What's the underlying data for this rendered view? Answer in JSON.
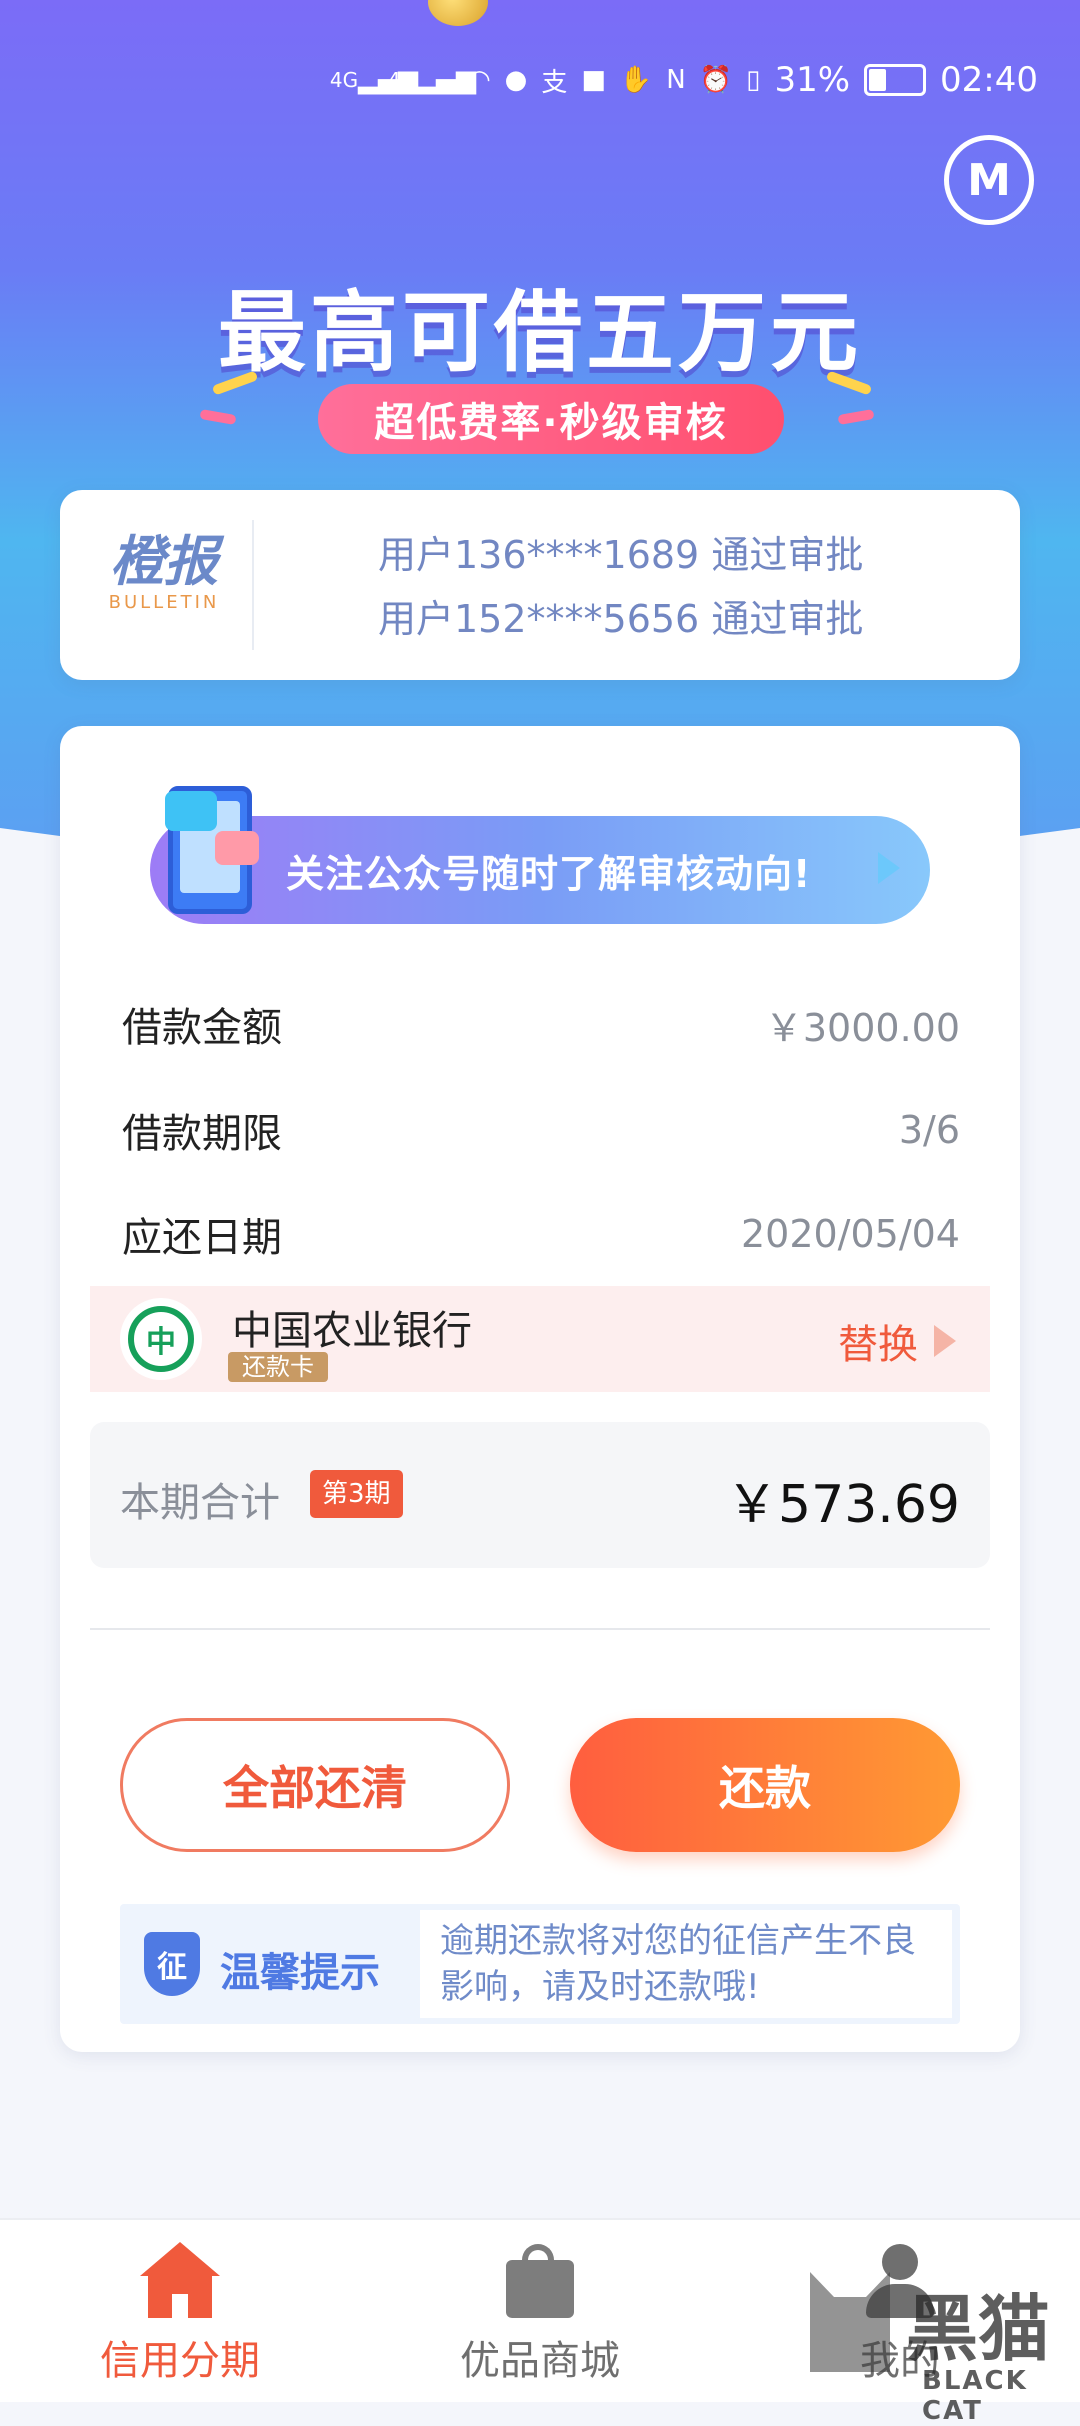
{
  "status_bar": {
    "network_1": "4G",
    "network_2": "4G",
    "battery": "31%",
    "time": "02:40"
  },
  "banner": {
    "headline": "最高可借五万元",
    "subtitle": "超低费率·秒级审核"
  },
  "bulletin": {
    "brand": "橙报",
    "brand_sub": "BULLETIN",
    "lines": [
      "用户136****1689 通过审批",
      "用户152****5656 通过审批"
    ]
  },
  "notice": {
    "text": "关注公众号随时了解审核动向!"
  },
  "loan": {
    "rows": [
      {
        "label": "借款金额",
        "value": "￥3000.00"
      },
      {
        "label": "借款期限",
        "value": "3/6"
      },
      {
        "label": "应还日期",
        "value": "2020/05/04"
      }
    ],
    "bank": {
      "name": "中国农业银行",
      "tag": "还款卡",
      "action": "替换"
    },
    "total": {
      "label": "本期合计",
      "period_badge": "第3期",
      "amount": "￥573.69"
    }
  },
  "actions": {
    "pay_all": "全部还清",
    "pay": "还款"
  },
  "tip": {
    "icon_char": "征",
    "label": "温馨提示",
    "text": "逾期还款将对您的征信产生不良影响，请及时还款哦!"
  },
  "tabbar": {
    "tabs": [
      {
        "label": "信用分期",
        "icon": "home-icon",
        "active": true
      },
      {
        "label": "优品商城",
        "icon": "shopping-bag-icon",
        "active": false
      },
      {
        "label": "我的",
        "icon": "user-icon",
        "active": false
      }
    ]
  },
  "watermark": {
    "cn": "黑猫",
    "en": "BLACK CAT"
  },
  "colors": {
    "accent": "#f05a3c",
    "hero_top": "#7b6cf7",
    "hero_mid": "#4fb6f0",
    "link_blue": "#7287c2",
    "bank_green": "#16a05a"
  }
}
